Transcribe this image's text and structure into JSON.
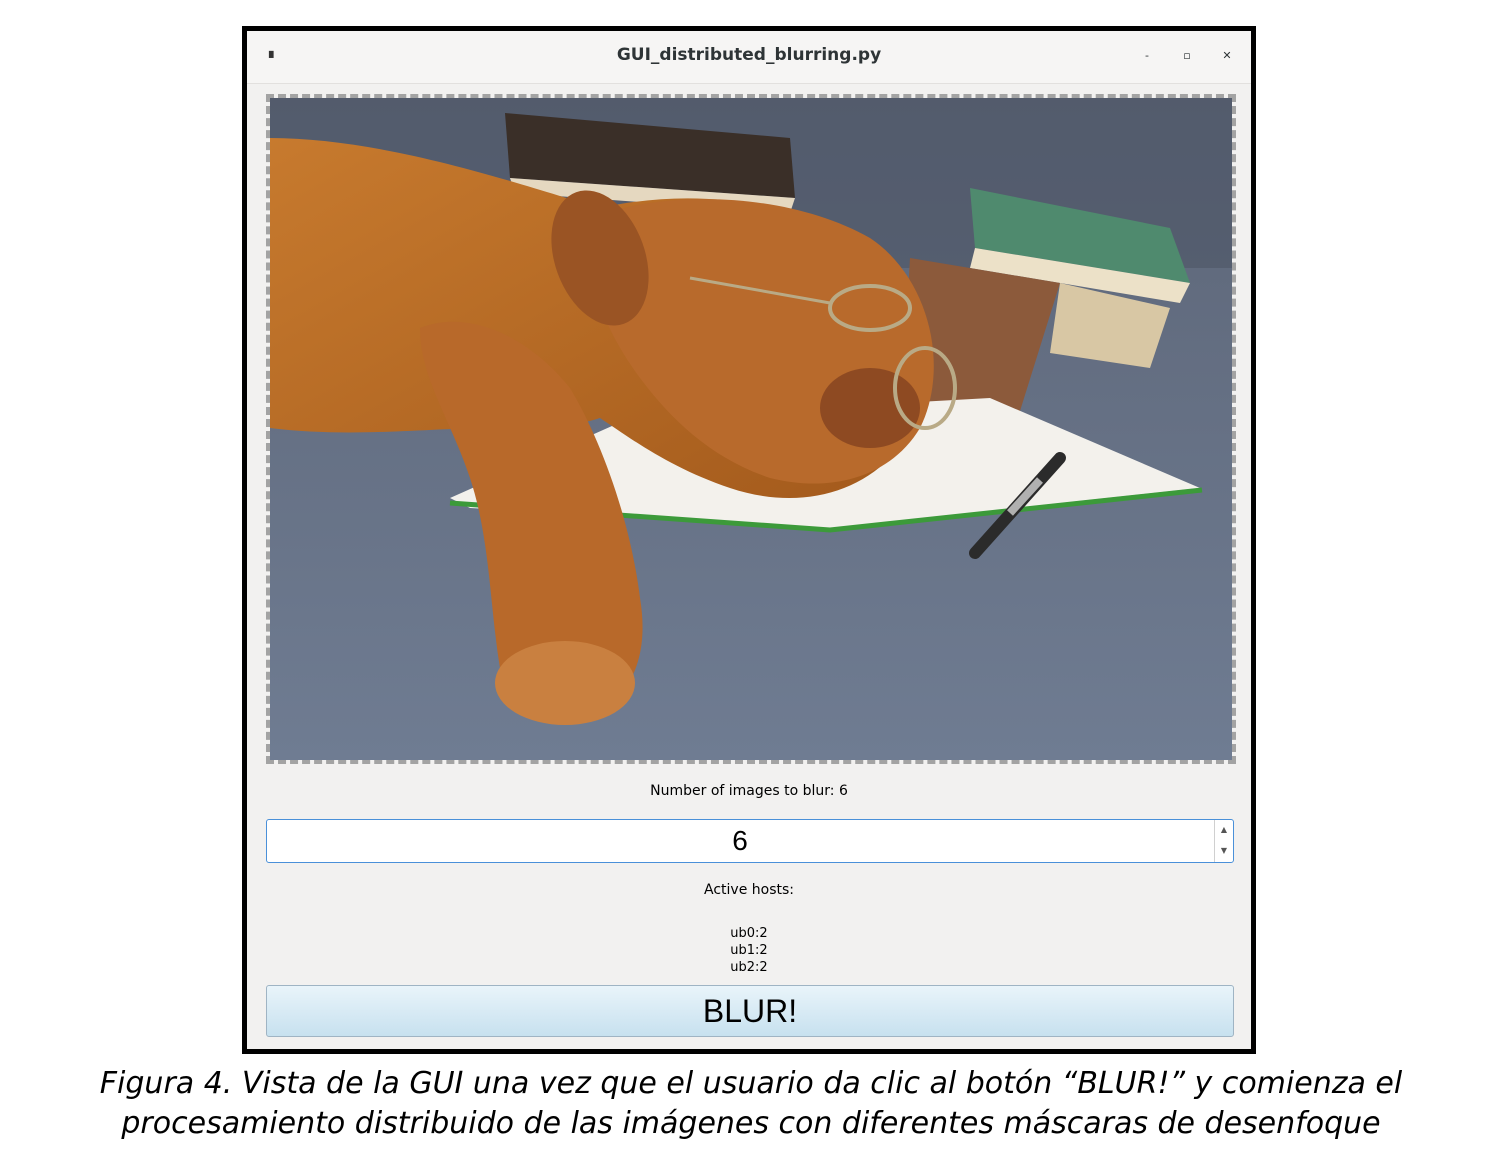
{
  "window": {
    "title": "GUI_distributed_blurring.py",
    "app_icon": "window-menu-icon",
    "controls": {
      "minimize": "-",
      "maximize": "▫",
      "close": "✕"
    }
  },
  "image": {
    "description_icon": "image-preview-icon"
  },
  "blur_count_label": "Number of images to blur: 6",
  "spinner": {
    "value": "6"
  },
  "hosts": {
    "title": "Active hosts:",
    "items": [
      "ub0:2",
      "ub1:2",
      "ub2:2"
    ]
  },
  "blur_button_label": "BLUR!",
  "caption": {
    "line1": "Figura 4. Vista de la GUI una vez que el usuario da clic al botón “BLUR!” y comienza el",
    "line2": "procesamiento distribuido de las imágenes con diferentes máscaras de desenfoque"
  },
  "colors": {
    "accent_border": "#4a90d9",
    "button_top": "#e9f4fa",
    "button_bottom": "#c7e1ef"
  }
}
